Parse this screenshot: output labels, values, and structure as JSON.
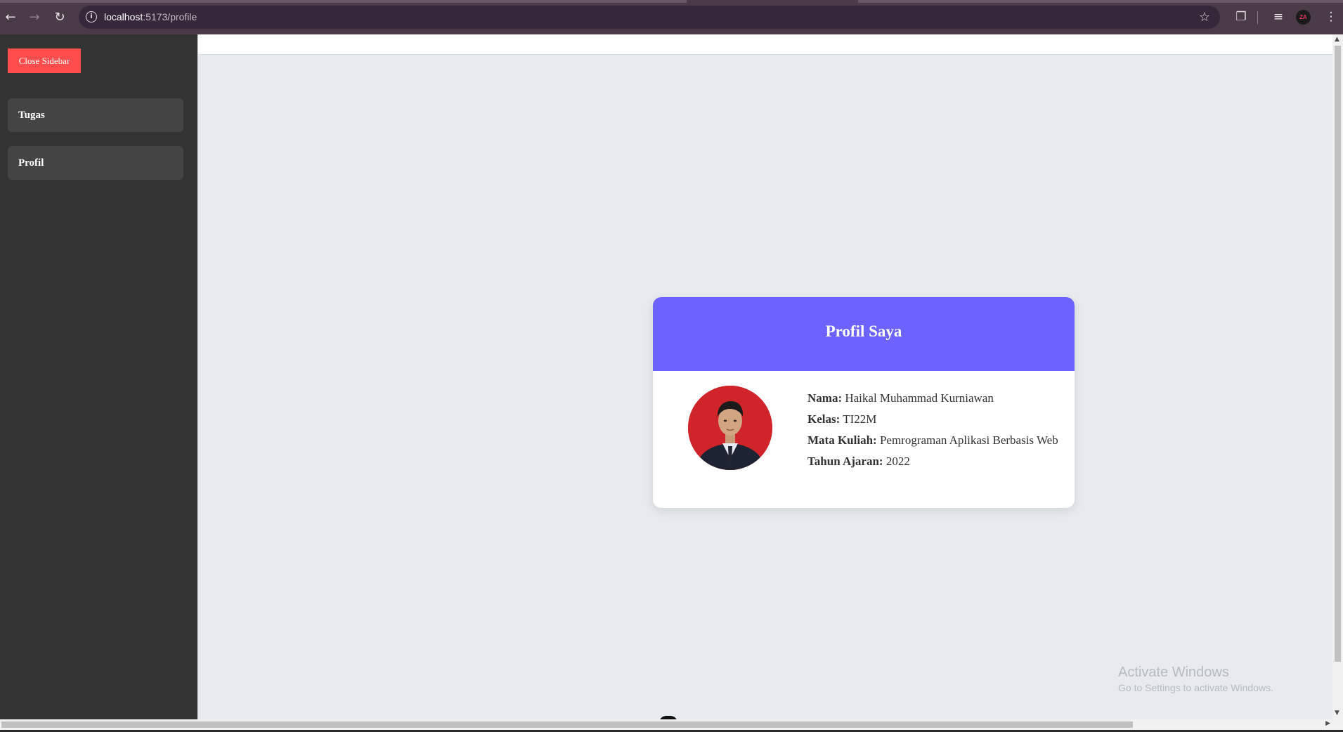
{
  "browser": {
    "url_host": "localhost",
    "url_path": ":5173/profile",
    "avatar_initials": "ZA",
    "icons": {
      "back": "arrow-left-icon",
      "forward": "arrow-right-icon",
      "reload": "reload-icon",
      "site_info": "info-icon",
      "bookmark": "star-icon",
      "extensions": "puzzle-icon",
      "media": "media-queue-icon",
      "menu": "kebab-menu-icon"
    }
  },
  "sidebar": {
    "close_label": "Close Sidebar",
    "items": [
      {
        "label": "Tugas"
      },
      {
        "label": "Profil"
      }
    ]
  },
  "profile": {
    "title": "Profil Saya",
    "fields": [
      {
        "key": "Nama:",
        "value": "Haikal Muhammad Kurniawan"
      },
      {
        "key": "Kelas:",
        "value": "TI22M"
      },
      {
        "key": "Mata Kuliah:",
        "value": "Pemrograman Aplikasi Berbasis Web"
      },
      {
        "key": "Tahun Ajaran:",
        "value": "2022"
      }
    ]
  },
  "watermark": {
    "title": "Activate Windows",
    "subtitle": "Go to Settings to activate Windows."
  },
  "colors": {
    "sidebar_bg": "#333333",
    "sidebar_item_bg": "#444444",
    "close_button": "#ff4d4d",
    "card_header": "#6c63ff",
    "page_bg": "#e7ebee"
  }
}
